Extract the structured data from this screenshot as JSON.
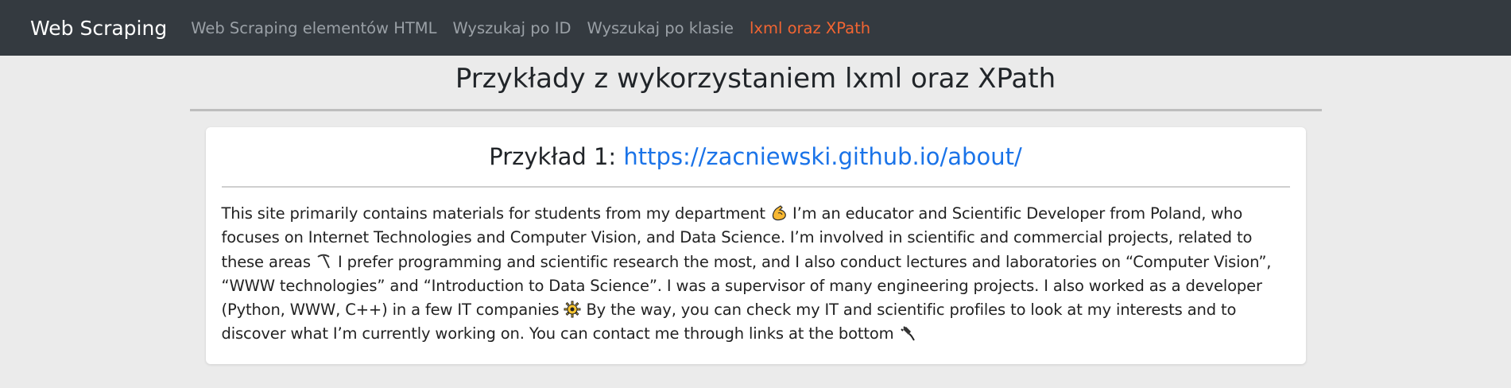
{
  "navbar": {
    "brand": "Web Scraping",
    "links": [
      {
        "label": "Web Scraping elementów HTML",
        "active": false
      },
      {
        "label": "Wyszukaj po ID",
        "active": false
      },
      {
        "label": "Wyszukaj po klasie",
        "active": false
      },
      {
        "label": "lxml oraz XPath",
        "active": true
      }
    ]
  },
  "main": {
    "title": "Przykłady z wykorzystaniem lxml oraz XPath",
    "card": {
      "title_prefix": "Przykład 1: ",
      "link": "https://zacniewski.github.io/about/",
      "text_segments": [
        "This site primarily contains materials for students from my department ",
        " I’m an educator and Scientific Developer from Poland, who focuses on Internet Technologies and Computer Vision, and Data Science. I’m involved in scientific and commercial projects, related to these areas ",
        " I prefer programming and scientific research the most, and I also conduct lectures and laboratories on “Computer Vision”, “WWW technologies” and “Introduction to Data Science”. I was a supervisor of many engineering projects. I also worked as a developer (Python, WWW, C++) in a few IT companies ",
        " By the way, you can check my IT and scientific profiles to look at my interests and to discover what I’m currently working on. You can contact me through links at the bottom "
      ],
      "icons": [
        "flexed-biceps-emoji",
        "pick-emoji",
        "gear-emoji",
        "plug-emoji"
      ]
    }
  },
  "colors": {
    "navbar_bg": "#343a40",
    "active_link": "#f26532",
    "link": "#1a73e8",
    "page_bg": "#ebebeb"
  }
}
